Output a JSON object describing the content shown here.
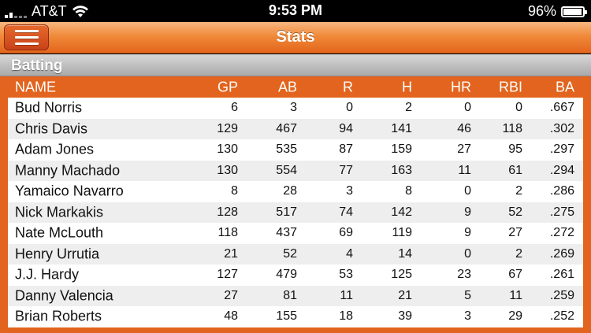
{
  "status_bar": {
    "carrier": "AT&T",
    "time": "9:53 PM",
    "battery_percent": "96%",
    "battery_level": 0.96
  },
  "nav": {
    "title": "Stats",
    "menu_icon": "hamburger-menu-icon"
  },
  "section": {
    "title": "Batting"
  },
  "table": {
    "columns": [
      "NAME",
      "GP",
      "AB",
      "R",
      "H",
      "HR",
      "RBI",
      "BA"
    ],
    "rows": [
      {
        "name": "Bud Norris",
        "gp": "6",
        "ab": "3",
        "r": "0",
        "h": "2",
        "hr": "0",
        "rbi": "0",
        "ba": ".667"
      },
      {
        "name": "Chris Davis",
        "gp": "129",
        "ab": "467",
        "r": "94",
        "h": "141",
        "hr": "46",
        "rbi": "118",
        "ba": ".302"
      },
      {
        "name": "Adam Jones",
        "gp": "130",
        "ab": "535",
        "r": "87",
        "h": "159",
        "hr": "27",
        "rbi": "95",
        "ba": ".297"
      },
      {
        "name": "Manny Machado",
        "gp": "130",
        "ab": "554",
        "r": "77",
        "h": "163",
        "hr": "11",
        "rbi": "61",
        "ba": ".294"
      },
      {
        "name": "Yamaico Navarro",
        "gp": "8",
        "ab": "28",
        "r": "3",
        "h": "8",
        "hr": "0",
        "rbi": "2",
        "ba": ".286"
      },
      {
        "name": "Nick Markakis",
        "gp": "128",
        "ab": "517",
        "r": "74",
        "h": "142",
        "hr": "9",
        "rbi": "52",
        "ba": ".275"
      },
      {
        "name": "Nate McLouth",
        "gp": "118",
        "ab": "437",
        "r": "69",
        "h": "119",
        "hr": "9",
        "rbi": "27",
        "ba": ".272"
      },
      {
        "name": "Henry Urrutia",
        "gp": "21",
        "ab": "52",
        "r": "4",
        "h": "14",
        "hr": "0",
        "rbi": "2",
        "ba": ".269"
      },
      {
        "name": "J.J. Hardy",
        "gp": "127",
        "ab": "479",
        "r": "53",
        "h": "125",
        "hr": "23",
        "rbi": "67",
        "ba": ".261"
      },
      {
        "name": "Danny Valencia",
        "gp": "27",
        "ab": "81",
        "r": "11",
        "h": "21",
        "hr": "5",
        "rbi": "11",
        "ba": ".259"
      },
      {
        "name": "Brian Roberts",
        "gp": "48",
        "ab": "155",
        "r": "18",
        "h": "39",
        "hr": "3",
        "rbi": "29",
        "ba": ".252"
      }
    ]
  },
  "colors": {
    "accent": "#e2641e",
    "nav_gradient_top": "#f7b780",
    "row_alt": "#eeeeee"
  }
}
